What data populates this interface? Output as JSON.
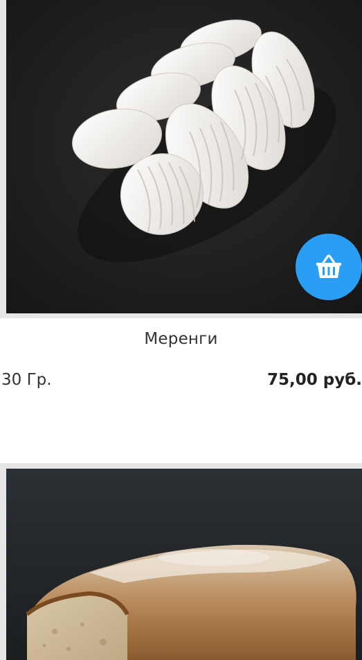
{
  "products": [
    {
      "name": "Меренги",
      "weight": "30 Гр.",
      "price": "75,00 руб.",
      "image_subject": "braided white meringue on dark background",
      "cart_icon": "basket-icon",
      "accent_color": "#2a9df4"
    },
    {
      "image_subject": "sliced crusty bread loaf on dark background"
    }
  ]
}
